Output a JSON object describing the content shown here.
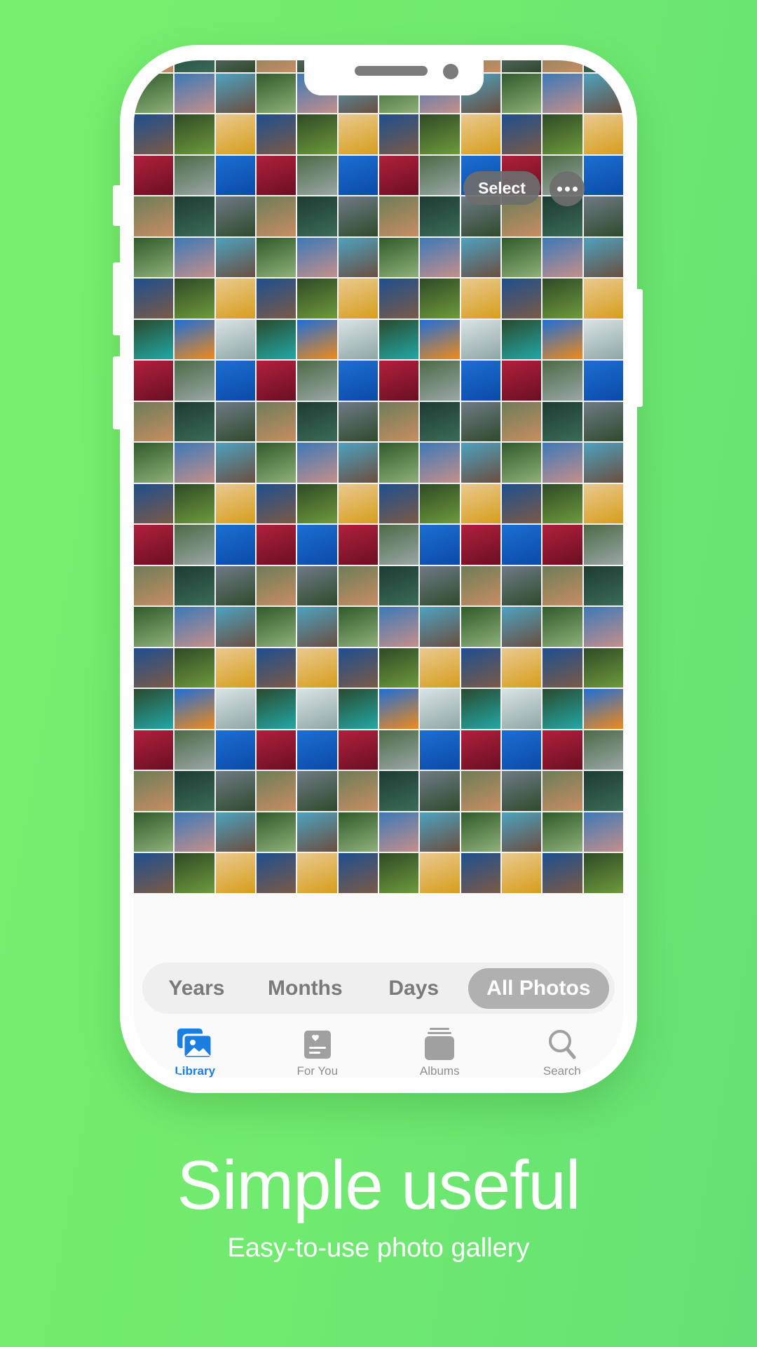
{
  "app": {
    "header": {
      "select_label": "Select",
      "more_icon": "ellipsis-icon"
    },
    "photo_grid": {
      "columns": 12,
      "photo_subjects": [
        "forest-trail",
        "pink-tree-lake",
        "coastal-cliff-beach",
        "mountain-lake-pier",
        "waterfall-meadow",
        "sunflowers",
        "raspberries",
        "tree-roadside",
        "underwater-diver",
        "aerial-pool-village",
        "green-leaves",
        "yosemite-waterfall",
        "turquoise-lake-forest",
        "butterfly-orange-flower",
        "sea-shore"
      ],
      "colors": {
        "forest-trail": [
          "#2f5b2a",
          "#8fb07a"
        ],
        "pink-tree-lake": [
          "#3c79b8",
          "#c58f8a"
        ],
        "coastal-cliff-beach": [
          "#4ca2c0",
          "#6b4e3f"
        ],
        "mountain-lake-pier": [
          "#1e4f8f",
          "#7a5a46"
        ],
        "waterfall-meadow": [
          "#2e4a26",
          "#6e9a3c"
        ],
        "sunflowers": [
          "#e9c98f",
          "#d79e1c"
        ],
        "raspberries": [
          "#b0203d",
          "#6a0f22"
        ],
        "tree-roadside": [
          "#4c6a46",
          "#9aa7a6"
        ],
        "underwater-diver": [
          "#1b6fd2",
          "#0b4aa8"
        ],
        "aerial-pool-village": [
          "#6d7d58",
          "#c88d63"
        ],
        "green-leaves": [
          "#1d3b32",
          "#3b6b58"
        ],
        "yosemite-waterfall": [
          "#6f7a86",
          "#2f4a2c"
        ],
        "turquoise-lake-forest": [
          "#2a4a2e",
          "#22a8a6"
        ],
        "butterfly-orange-flower": [
          "#1f6ed9",
          "#f08a18"
        ],
        "sea-shore": [
          "#d9e3e4",
          "#8fa6a6"
        ]
      },
      "rows": [
        [
          "aerial-pool-village",
          "green-leaves",
          "yosemite-waterfall",
          "aerial-pool-village",
          "yosemite-waterfall",
          "aerial-pool-village",
          "green-leaves",
          "yosemite-waterfall",
          "aerial-pool-village",
          "yosemite-waterfall",
          "aerial-pool-village",
          "green-leaves"
        ],
        [
          "forest-trail",
          "pink-tree-lake",
          "coastal-cliff-beach",
          "forest-trail",
          "pink-tree-lake",
          "coastal-cliff-beach",
          "forest-trail",
          "pink-tree-lake",
          "coastal-cliff-beach",
          "forest-trail",
          "pink-tree-lake",
          "coastal-cliff-beach"
        ],
        [
          "mountain-lake-pier",
          "waterfall-meadow",
          "sunflowers",
          "mountain-lake-pier",
          "waterfall-meadow",
          "sunflowers",
          "mountain-lake-pier",
          "waterfall-meadow",
          "sunflowers",
          "mountain-lake-pier",
          "waterfall-meadow",
          "sunflowers"
        ],
        [
          "raspberries",
          "tree-roadside",
          "underwater-diver",
          "raspberries",
          "tree-roadside",
          "underwater-diver",
          "raspberries",
          "tree-roadside",
          "underwater-diver",
          "raspberries",
          "tree-roadside",
          "underwater-diver"
        ],
        [
          "aerial-pool-village",
          "green-leaves",
          "yosemite-waterfall",
          "aerial-pool-village",
          "green-leaves",
          "yosemite-waterfall",
          "aerial-pool-village",
          "green-leaves",
          "yosemite-waterfall",
          "aerial-pool-village",
          "green-leaves",
          "yosemite-waterfall"
        ],
        [
          "forest-trail",
          "pink-tree-lake",
          "coastal-cliff-beach",
          "forest-trail",
          "pink-tree-lake",
          "coastal-cliff-beach",
          "forest-trail",
          "pink-tree-lake",
          "coastal-cliff-beach",
          "forest-trail",
          "pink-tree-lake",
          "coastal-cliff-beach"
        ],
        [
          "mountain-lake-pier",
          "waterfall-meadow",
          "sunflowers",
          "mountain-lake-pier",
          "waterfall-meadow",
          "sunflowers",
          "mountain-lake-pier",
          "waterfall-meadow",
          "sunflowers",
          "mountain-lake-pier",
          "waterfall-meadow",
          "sunflowers"
        ],
        [
          "turquoise-lake-forest",
          "butterfly-orange-flower",
          "sea-shore",
          "turquoise-lake-forest",
          "butterfly-orange-flower",
          "sea-shore",
          "turquoise-lake-forest",
          "butterfly-orange-flower",
          "sea-shore",
          "turquoise-lake-forest",
          "butterfly-orange-flower",
          "sea-shore"
        ],
        [
          "raspberries",
          "tree-roadside",
          "underwater-diver",
          "raspberries",
          "tree-roadside",
          "underwater-diver",
          "raspberries",
          "tree-roadside",
          "underwater-diver",
          "raspberries",
          "tree-roadside",
          "underwater-diver"
        ],
        [
          "aerial-pool-village",
          "green-leaves",
          "yosemite-waterfall",
          "aerial-pool-village",
          "green-leaves",
          "yosemite-waterfall",
          "aerial-pool-village",
          "green-leaves",
          "yosemite-waterfall",
          "aerial-pool-village",
          "green-leaves",
          "yosemite-waterfall"
        ],
        [
          "forest-trail",
          "pink-tree-lake",
          "coastal-cliff-beach",
          "forest-trail",
          "pink-tree-lake",
          "coastal-cliff-beach",
          "forest-trail",
          "pink-tree-lake",
          "coastal-cliff-beach",
          "forest-trail",
          "pink-tree-lake",
          "coastal-cliff-beach"
        ],
        [
          "mountain-lake-pier",
          "waterfall-meadow",
          "sunflowers",
          "mountain-lake-pier",
          "waterfall-meadow",
          "sunflowers",
          "mountain-lake-pier",
          "waterfall-meadow",
          "sunflowers",
          "mountain-lake-pier",
          "waterfall-meadow",
          "sunflowers"
        ],
        [
          "raspberries",
          "tree-roadside",
          "underwater-diver",
          "raspberries",
          "underwater-diver",
          "raspberries",
          "tree-roadside",
          "underwater-diver",
          "raspberries",
          "underwater-diver",
          "raspberries",
          "tree-roadside"
        ],
        [
          "aerial-pool-village",
          "green-leaves",
          "yosemite-waterfall",
          "aerial-pool-village",
          "yosemite-waterfall",
          "aerial-pool-village",
          "green-leaves",
          "yosemite-waterfall",
          "aerial-pool-village",
          "yosemite-waterfall",
          "aerial-pool-village",
          "green-leaves"
        ],
        [
          "forest-trail",
          "pink-tree-lake",
          "coastal-cliff-beach",
          "forest-trail",
          "coastal-cliff-beach",
          "forest-trail",
          "pink-tree-lake",
          "coastal-cliff-beach",
          "forest-trail",
          "coastal-cliff-beach",
          "forest-trail",
          "pink-tree-lake"
        ],
        [
          "mountain-lake-pier",
          "waterfall-meadow",
          "sunflowers",
          "mountain-lake-pier",
          "sunflowers",
          "mountain-lake-pier",
          "waterfall-meadow",
          "sunflowers",
          "mountain-lake-pier",
          "sunflowers",
          "mountain-lake-pier",
          "waterfall-meadow"
        ],
        [
          "turquoise-lake-forest",
          "butterfly-orange-flower",
          "sea-shore",
          "turquoise-lake-forest",
          "sea-shore",
          "turquoise-lake-forest",
          "butterfly-orange-flower",
          "sea-shore",
          "turquoise-lake-forest",
          "sea-shore",
          "turquoise-lake-forest",
          "butterfly-orange-flower"
        ],
        [
          "raspberries",
          "tree-roadside",
          "underwater-diver",
          "raspberries",
          "underwater-diver",
          "raspberries",
          "tree-roadside",
          "underwater-diver",
          "raspberries",
          "underwater-diver",
          "raspberries",
          "tree-roadside"
        ],
        [
          "aerial-pool-village",
          "green-leaves",
          "yosemite-waterfall",
          "aerial-pool-village",
          "yosemite-waterfall",
          "aerial-pool-village",
          "green-leaves",
          "yosemite-waterfall",
          "aerial-pool-village",
          "yosemite-waterfall",
          "aerial-pool-village",
          "green-leaves"
        ],
        [
          "forest-trail",
          "pink-tree-lake",
          "coastal-cliff-beach",
          "forest-trail",
          "coastal-cliff-beach",
          "forest-trail",
          "pink-tree-lake",
          "coastal-cliff-beach",
          "forest-trail",
          "coastal-cliff-beach",
          "forest-trail",
          "pink-tree-lake"
        ],
        [
          "mountain-lake-pier",
          "waterfall-meadow",
          "sunflowers",
          "mountain-lake-pier",
          "sunflowers",
          "mountain-lake-pier",
          "waterfall-meadow",
          "sunflowers",
          "mountain-lake-pier",
          "sunflowers",
          "mountain-lake-pier",
          "waterfall-meadow"
        ]
      ]
    },
    "segmented_control": {
      "options": [
        "Years",
        "Months",
        "Days",
        "All Photos"
      ],
      "selected": "All Photos"
    },
    "tab_bar": {
      "items": [
        {
          "label": "Library",
          "icon": "photo-library-icon",
          "active": true
        },
        {
          "label": "For You",
          "icon": "for-you-icon",
          "active": false
        },
        {
          "label": "Albums",
          "icon": "albums-icon",
          "active": false
        },
        {
          "label": "Search",
          "icon": "search-icon",
          "active": false
        }
      ],
      "active_color": "#1a7fe0",
      "inactive_color": "#8e8e8e"
    }
  },
  "marketing": {
    "headline": "Simple useful",
    "subheadline": "Easy-to-use photo gallery"
  },
  "colors": {
    "background": "#70ea6f",
    "frame": "#fefefe"
  }
}
